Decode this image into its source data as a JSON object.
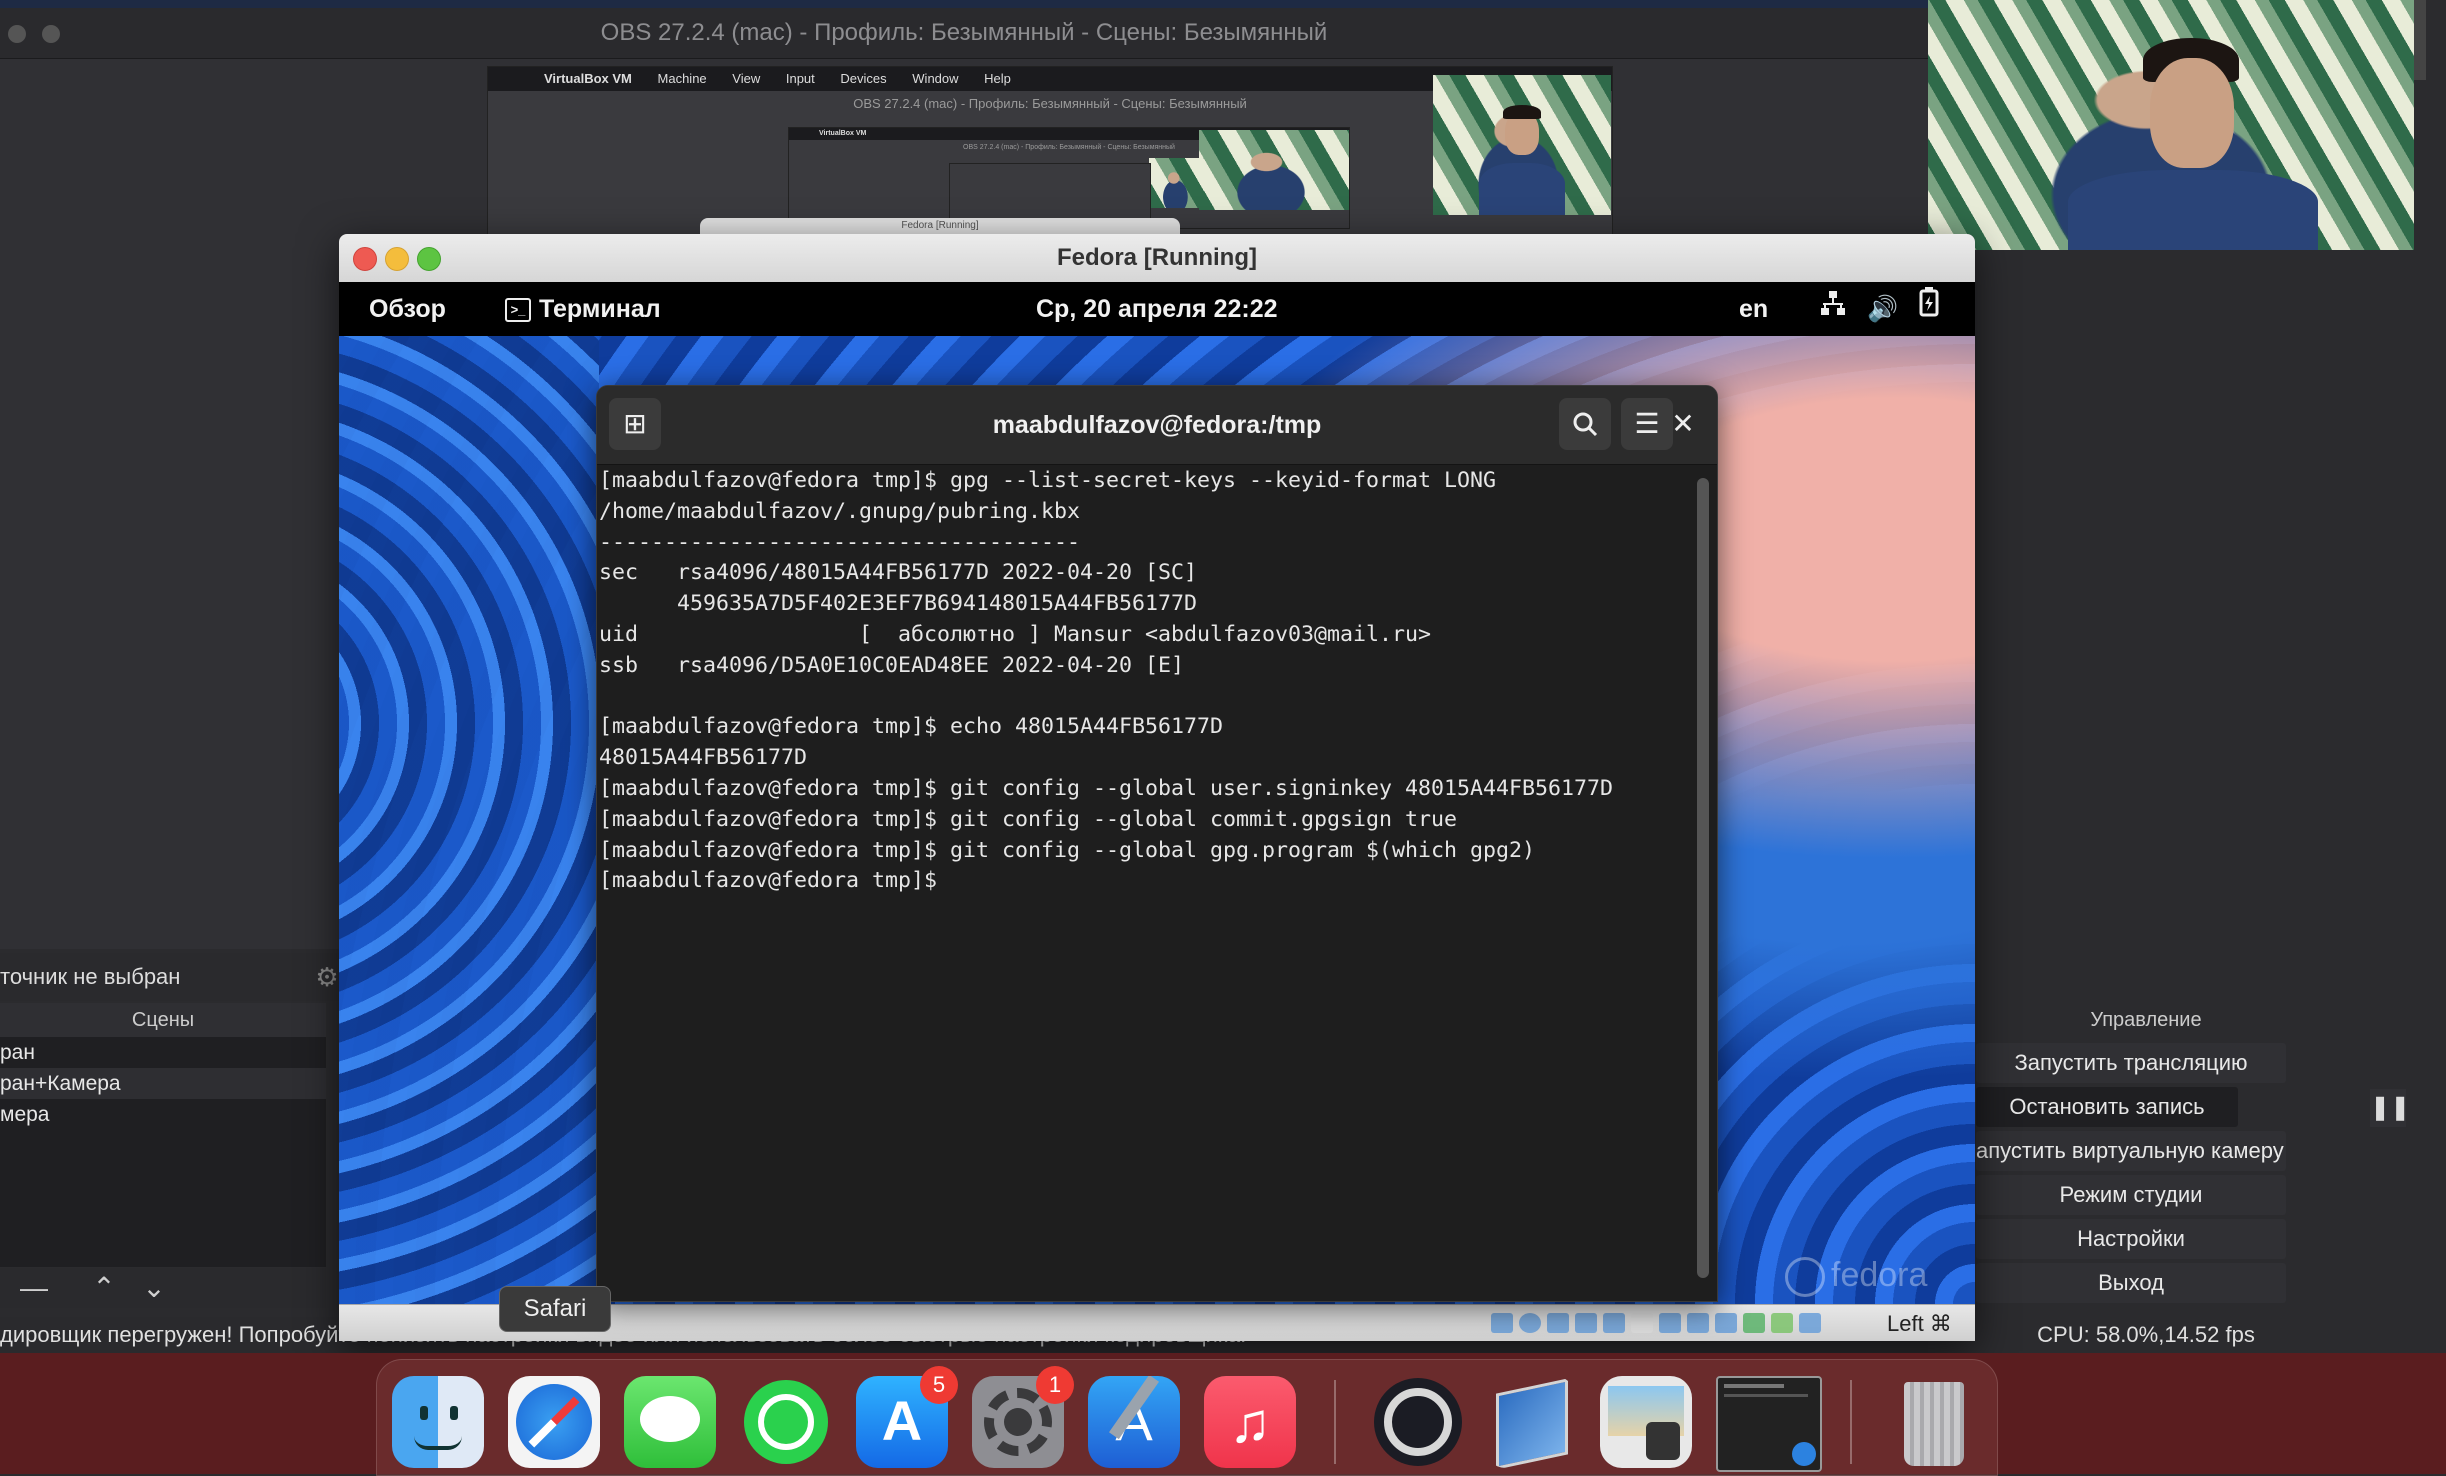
{
  "obs": {
    "title": "OBS 27.2.4 (mac) - Профиль: Безымянный - Сцены: Безымянный",
    "source_label": "точник не выбран",
    "scenes_header": "Сцены",
    "scenes": [
      "ран",
      "ран+Камера",
      "мера"
    ],
    "controls_header": "Управление",
    "controls": {
      "start_stream": "Запустить трансляцию",
      "stop_record": "Остановить запись",
      "virtual_cam": "апустить виртуальную камеру",
      "studio_mode": "Режим студии",
      "settings": "Настройки",
      "exit": "Выход"
    },
    "pause_glyph": "❚❚",
    "status_message": "дировщик перегружен! Попробуйте понизить настройки видео или использовать более быстрые настройки кодировщика.",
    "cpu_status": "CPU: 58.0%,14.52 fps"
  },
  "nested": {
    "menubar": {
      "app": "VirtualBox VM",
      "items": [
        "Machine",
        "View",
        "Input",
        "Devices",
        "Window",
        "Help"
      ]
    },
    "obs_title": "OBS 27.2.4 (mac) - Профиль: Безымянный - Сцены: Безымянный",
    "fedora_title": "Fedora [Running]"
  },
  "vbox": {
    "title": "Fedora [Running]",
    "host_key": "Left ⌘"
  },
  "gnome": {
    "activities": "Обзор",
    "app_name": "Терминал",
    "clock": "Ср, 20 апреля  22:22",
    "keyboard": "en"
  },
  "terminal": {
    "title": "maabdulfazov@fedora:/tmp",
    "lines": [
      "[maabdulfazov@fedora tmp]$ gpg --list-secret-keys --keyid-format LONG",
      "/home/maabdulfazov/.gnupg/pubring.kbx",
      "-------------------------------------",
      "sec   rsa4096/48015A44FB56177D 2022-04-20 [SC]",
      "      459635A7D5F402E3EF7B694148015A44FB56177D",
      "uid                 [  абсолютно ] Mansur <abdulfazov03@mail.ru>",
      "ssb   rsa4096/D5A0E10C0EAD48EE 2022-04-20 [E]",
      "",
      "[maabdulfazov@fedora tmp]$ echo 48015A44FB56177D",
      "48015A44FB56177D",
      "[maabdulfazov@fedora tmp]$ git config --global user.signinkey 48015A44FB56177D",
      "[maabdulfazov@fedora tmp]$ git config --global commit.gpgsign true",
      "[maabdulfazov@fedora tmp]$ git config --global gpg.program $(which gpg2)",
      "[maabdulfazov@fedora tmp]$ "
    ]
  },
  "desktop": {
    "brand": "fedora"
  },
  "dock": {
    "tooltip": "Safari",
    "badges": {
      "app_store": "5",
      "system_prefs": "1"
    }
  },
  "colors": {
    "obs_bg": "#2b2b2e",
    "terminal_bg": "#1e1e1e",
    "gnome_bar": "#000000",
    "dock": "#5a1d1f",
    "badge": "#ef3a33"
  }
}
